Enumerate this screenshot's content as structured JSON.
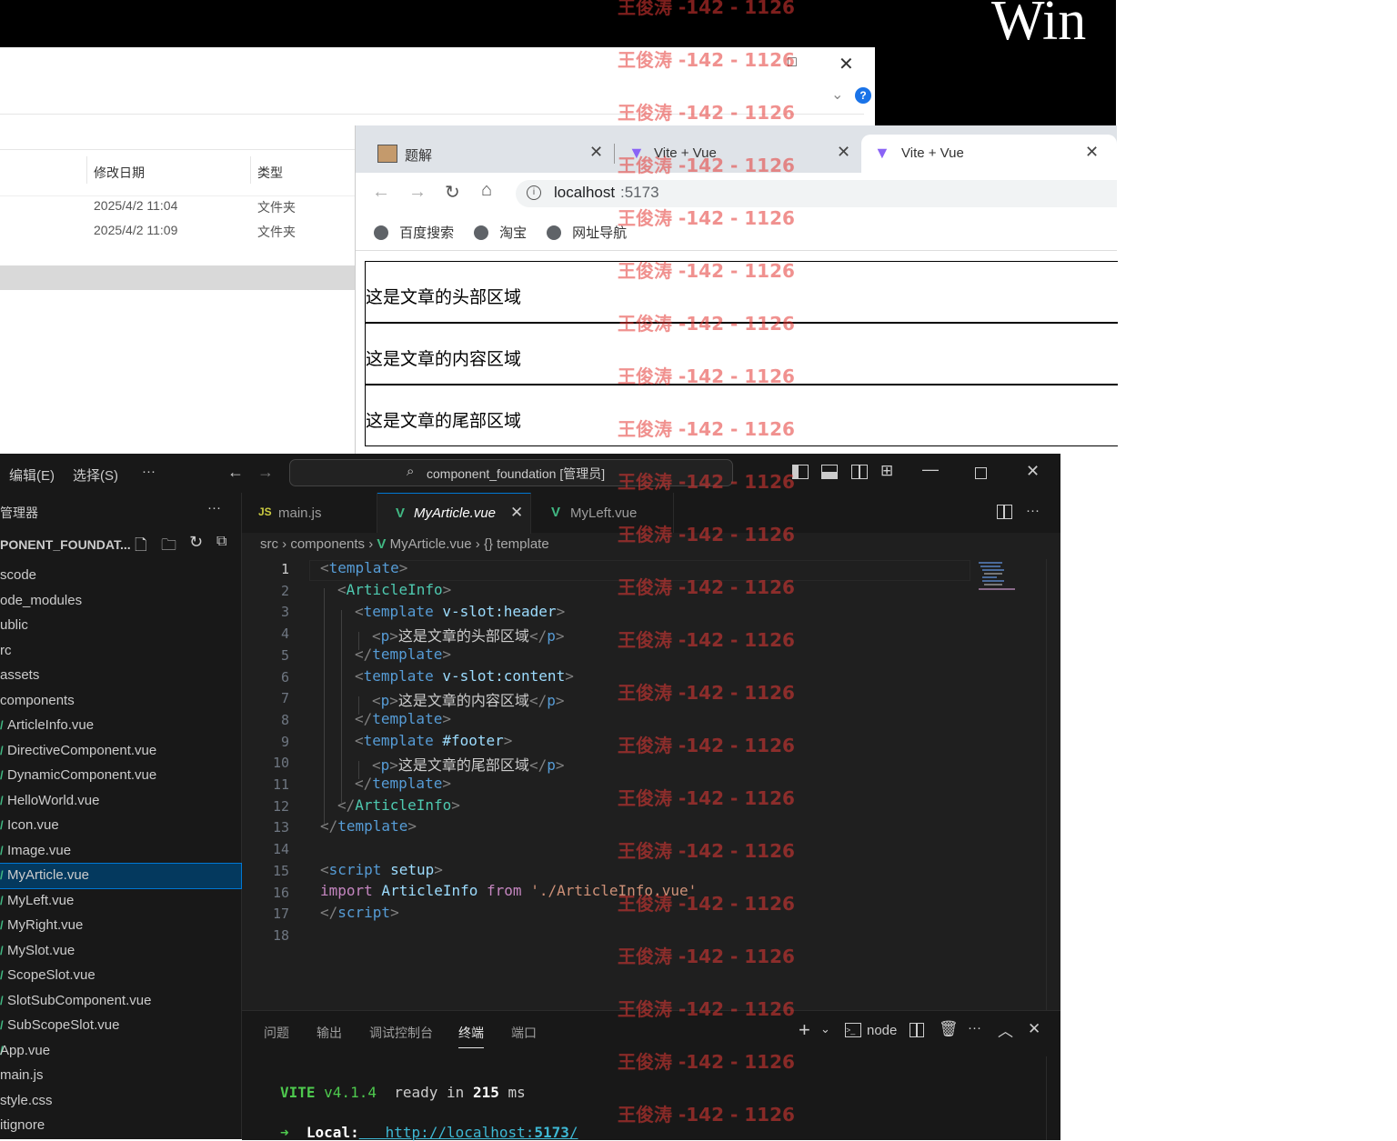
{
  "desktop": {
    "brand_fragment": "Win"
  },
  "explorer": {
    "columns": [
      "修改日期",
      "类型"
    ],
    "rows": [
      {
        "date": "2025/4/2 11:04",
        "type": "文件夹"
      },
      {
        "date": "2025/4/2 11:09",
        "type": "文件夹"
      }
    ],
    "help": "?"
  },
  "browser": {
    "tabs": [
      {
        "title": "题解",
        "close": "✕"
      },
      {
        "title": "Vite + Vue",
        "close": "✕"
      },
      {
        "title": "Vite + Vue",
        "close": "✕"
      }
    ],
    "active_tab": 2,
    "url_host": "localhost",
    "url_port": ":5173",
    "bookmarks": [
      "百度搜索",
      "淘宝",
      "网址导航"
    ],
    "page": {
      "header": "这是文章的头部区域",
      "content": "这是文章的内容区域",
      "footer": "这是文章的尾部区域"
    }
  },
  "vscode": {
    "menus": [
      "编辑(E)",
      "选择(S)",
      "···"
    ],
    "search": "component_foundation [管理员]",
    "explorer_title": "管理器",
    "project": "PONENT_FOUNDAT...",
    "tree": [
      {
        "label": "scode",
        "type": "folder"
      },
      {
        "label": "ode_modules",
        "type": "folder"
      },
      {
        "label": "ublic",
        "type": "folder"
      },
      {
        "label": "rc",
        "type": "folder"
      },
      {
        "label": "assets",
        "type": "folder"
      },
      {
        "label": "components",
        "type": "folder"
      },
      {
        "label": "ArticleInfo.vue",
        "type": "vue"
      },
      {
        "label": "DirectiveComponent.vue",
        "type": "vue"
      },
      {
        "label": "DynamicComponent.vue",
        "type": "vue"
      },
      {
        "label": "HelloWorld.vue",
        "type": "vue"
      },
      {
        "label": "Icon.vue",
        "type": "vue"
      },
      {
        "label": "Image.vue",
        "type": "vue"
      },
      {
        "label": "MyArticle.vue",
        "type": "vue",
        "selected": true
      },
      {
        "label": "MyLeft.vue",
        "type": "vue"
      },
      {
        "label": "MyRight.vue",
        "type": "vue"
      },
      {
        "label": "MySlot.vue",
        "type": "vue"
      },
      {
        "label": "ScopeSlot.vue",
        "type": "vue"
      },
      {
        "label": "SlotSubComponent.vue",
        "type": "vue"
      },
      {
        "label": "SubScopeSlot.vue",
        "type": "vue"
      },
      {
        "label": "App.vue",
        "type": "vue"
      },
      {
        "label": "main.js",
        "type": "js"
      },
      {
        "label": "style.css",
        "type": "css"
      },
      {
        "label": "itignore",
        "type": "file"
      }
    ],
    "editor_tabs": [
      {
        "icon": "JS",
        "label": "main.js"
      },
      {
        "icon": "V",
        "label": "MyArticle.vue",
        "active": true,
        "close": "✕"
      },
      {
        "icon": "V",
        "label": "MyLeft.vue"
      }
    ],
    "breadcrumb": {
      "a": "src",
      "b": "components",
      "c": "MyArticle.vue",
      "d": "{} template"
    },
    "line_numbers": [
      "1",
      "2",
      "3",
      "4",
      "5",
      "6",
      "7",
      "8",
      "9",
      "10",
      "11",
      "12",
      "13",
      "14",
      "15",
      "16",
      "17",
      "18"
    ],
    "code": {
      "l1": {
        "open": "<",
        "tag": "template",
        "close": ">"
      },
      "l2": {
        "open": "<",
        "tag": "ArticleInfo",
        "close": ">"
      },
      "l3": {
        "open": "<",
        "tag": "template",
        "attr": " v-slot:header",
        "close": ">"
      },
      "l4": {
        "open": "<",
        "tag": "p",
        "close": ">",
        "text": "这是文章的头部区域",
        "open2": "</",
        "tag2": "p",
        "close2": ">"
      },
      "l5": {
        "open": "</",
        "tag": "template",
        "close": ">"
      },
      "l6": {
        "open": "<",
        "tag": "template",
        "attr": " v-slot:content",
        "close": ">"
      },
      "l7": {
        "open": "<",
        "tag": "p",
        "close": ">",
        "text": "这是文章的内容区域",
        "open2": "</",
        "tag2": "p",
        "close2": ">"
      },
      "l8": {
        "open": "</",
        "tag": "template",
        "close": ">"
      },
      "l9": {
        "open": "<",
        "tag": "template",
        "attr": " #footer",
        "close": ">"
      },
      "l10": {
        "open": "<",
        "tag": "p",
        "close": ">",
        "text": "这是文章的尾部区域",
        "open2": "</",
        "tag2": "p",
        "close2": ">"
      },
      "l11": {
        "open": "</",
        "tag": "template",
        "close": ">"
      },
      "l12": {
        "open": "</",
        "tag": "ArticleInfo",
        "close": ">"
      },
      "l13": {
        "open": "</",
        "tag": "template",
        "close": ">"
      },
      "l15": {
        "open": "<",
        "tag": "script",
        "attr": " setup",
        "close": ">"
      },
      "l16": {
        "kw1": "import",
        "name": " ArticleInfo ",
        "kw2": "from",
        "str": " './ArticleInfo.vue'"
      },
      "l17": {
        "open": "</",
        "tag": "script",
        "close": ">"
      }
    },
    "panel_tabs": [
      "问题",
      "输出",
      "调试控制台",
      "终端",
      "端口"
    ],
    "panel_active": "终端",
    "terminal_name": "node",
    "terminal": {
      "vite": "VITE",
      "version": " v4.1.4",
      "ready": "  ready in ",
      "ms_value": "215",
      "ms": " ms",
      "arrow": "➜",
      "local_label": "  Local:",
      "url_a": "   http://localhost:",
      "url_port": "5173",
      "url_b": "/"
    }
  },
  "watermark": {
    "text": "王俊涛 -142 - 1126"
  },
  "colors": {
    "vscode_bg": "#1f1f1f",
    "vue_green": "#41b883",
    "accent_blue": "#0078d4",
    "watermark_red": "#e53935"
  }
}
